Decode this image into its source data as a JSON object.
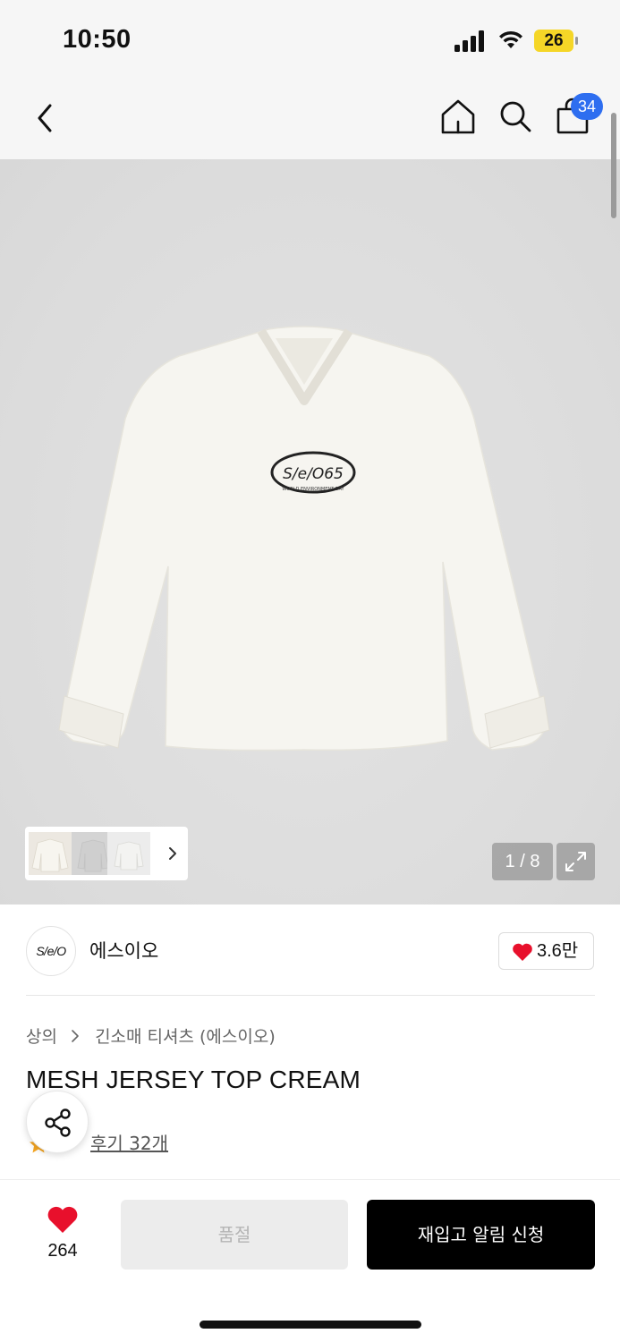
{
  "status_bar": {
    "time": "10:50",
    "battery": "26",
    "battery_color": "#f5d627"
  },
  "header": {
    "back_icon": "chevron-left-icon",
    "home_icon": "home-icon",
    "search_icon": "search-icon",
    "cart_icon": "shopping-bag-icon",
    "cart_badge": "34",
    "badge_color": "#2e6ef0"
  },
  "gallery": {
    "page_counter": "1 / 8",
    "expand_icon": "expand-icon"
  },
  "brand": {
    "logo_text": "S/e/O",
    "name": "에스이오",
    "likes": "3.6만",
    "heart_color": "#e8102c"
  },
  "product": {
    "breadcrumb": [
      "상의",
      "긴소매 티셔츠 (에스이오)"
    ],
    "title": "MESH JERSEY TOP CREAM",
    "review_link": "후기 32개"
  },
  "bottom_bar": {
    "wish_count": "264",
    "soldout_label": "품절",
    "restock_label": "재입고 알림 신청"
  }
}
